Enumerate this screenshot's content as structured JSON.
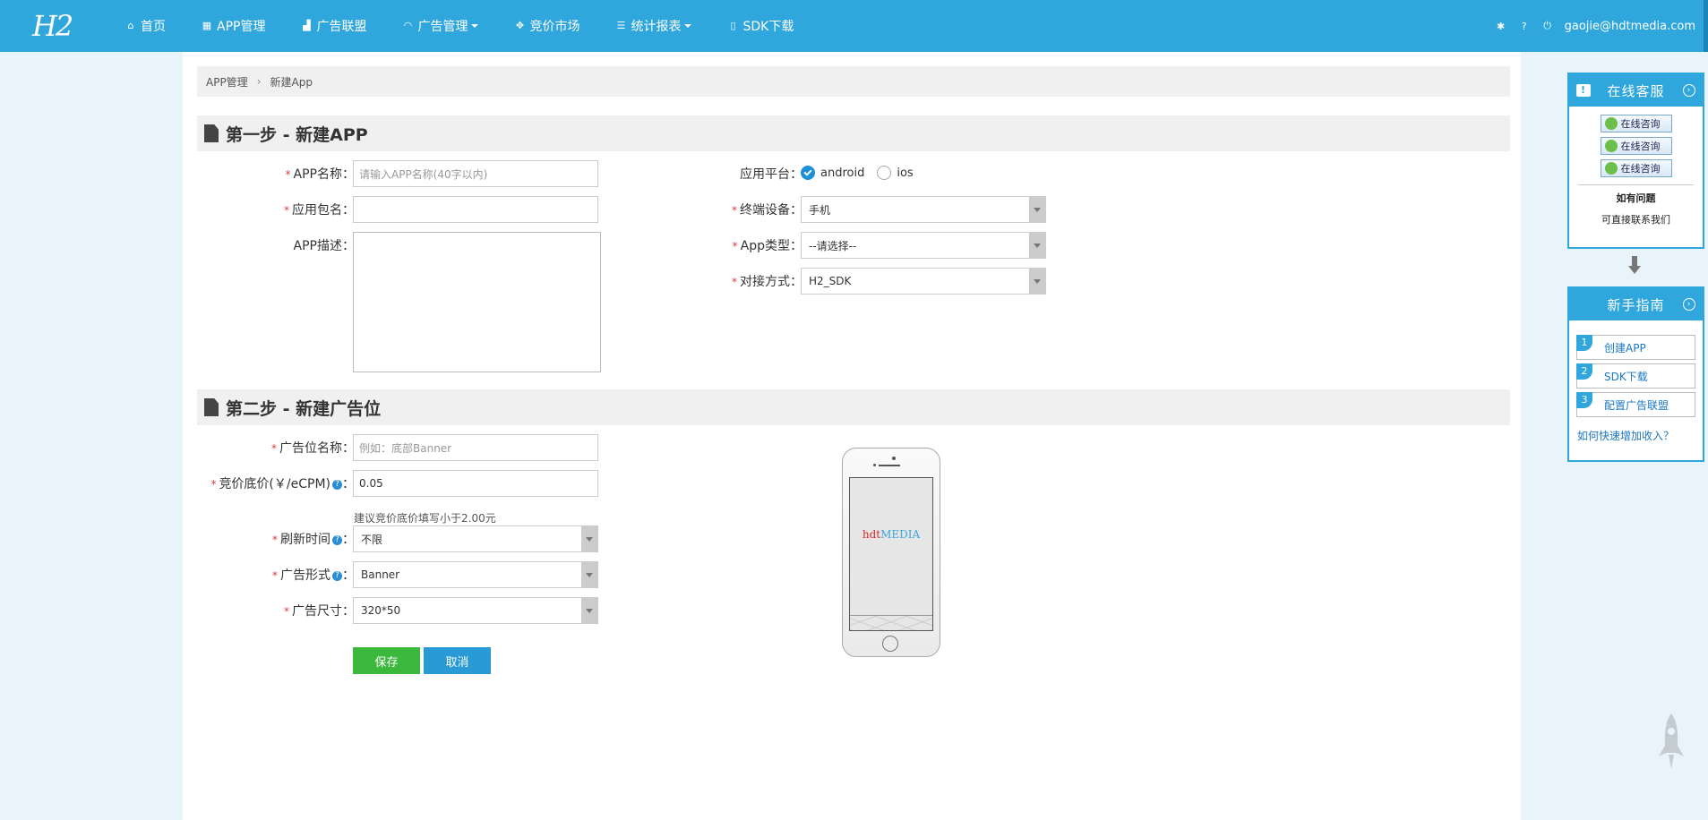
{
  "brand": {
    "logo": "H2"
  },
  "nav": {
    "items": [
      {
        "label": "首页",
        "icon": "home-icon"
      },
      {
        "label": "APP管理",
        "icon": "grid-icon"
      },
      {
        "label": "广告联盟",
        "icon": "signal-icon"
      },
      {
        "label": "广告管理",
        "icon": "headset-icon",
        "dropdown": true
      },
      {
        "label": "竞价市场",
        "icon": "expand-icon"
      },
      {
        "label": "统计报表",
        "icon": "list-icon",
        "dropdown": true
      },
      {
        "label": "SDK下载",
        "icon": "file-icon"
      }
    ],
    "user_email": "gaojie@hdtmedia.com"
  },
  "breadcrumb": {
    "root": "APP管理",
    "current": "新建App",
    "separator": "›"
  },
  "step1": {
    "title": "第一步 - 新建APP",
    "app_name_label": "APP名称：",
    "app_name_placeholder": "请输入APP名称(40字以内)",
    "package_label": "应用包名：",
    "desc_label": "APP描述：",
    "platform_label": "应用平台：",
    "platform_options": [
      "android",
      "ios"
    ],
    "platform_selected": "android",
    "device_label": "终端设备：",
    "device_value": "手机",
    "app_type_label": "App类型：",
    "app_type_value": "--请选择--",
    "integration_label": "对接方式：",
    "integration_value": "H2_SDK"
  },
  "step2": {
    "title": "第二步 - 新建广告位",
    "slot_name_label": "广告位名称：",
    "slot_name_placeholder": "例如：底部Banner",
    "floor_price_label": "竞价底价(￥/eCPM)",
    "floor_price_suffix": "：",
    "floor_price_value": "0.05",
    "floor_price_hint": "建议竞价底价填写小于2.00元",
    "refresh_label": "刷新时间",
    "refresh_value": "不限",
    "format_label": "广告形式",
    "format_value": "Banner",
    "size_label": "广告尺寸：",
    "size_value": "320*50",
    "colon": "：",
    "save_label": "保存",
    "cancel_label": "取消"
  },
  "preview": {
    "brand_red": "hdt",
    "brand_blue": "MEDIA"
  },
  "sidebar": {
    "service_title": "在线客服",
    "consult_label": "在线咨询",
    "question_title": "如有问题",
    "question_sub": "可直接联系我们",
    "guide_title": "新手指南",
    "guide_items": [
      {
        "num": "1",
        "label": "创建APP"
      },
      {
        "num": "2",
        "label": "SDK下载"
      },
      {
        "num": "3",
        "label": "配置广告联盟"
      }
    ],
    "guide_link": "如何快速增加收入？"
  },
  "colors": {
    "primary": "#2fa6dc",
    "save": "#3cb83c",
    "cancel": "#2a9ad6",
    "required": "#e03a3a"
  }
}
